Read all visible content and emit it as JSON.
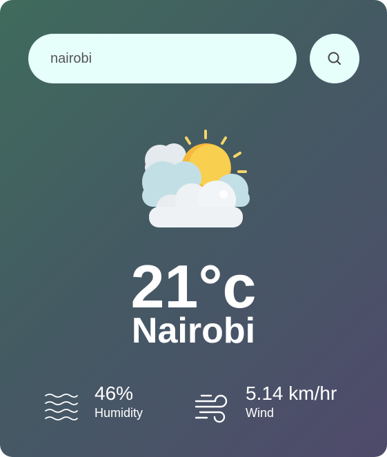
{
  "search": {
    "value": "nairobi",
    "placeholder": ""
  },
  "icons": {
    "search_button": "search-icon",
    "condition": "partly-cloudy-icon",
    "humidity": "water-waves-icon",
    "wind": "wind-icon"
  },
  "weather": {
    "temperature": "21°c",
    "city": "Nairobi"
  },
  "details": {
    "humidity": {
      "value": "46%",
      "label": "Humidity"
    },
    "wind": {
      "value": "5.14 km/hr",
      "label": "Wind"
    }
  },
  "colors": {
    "input_bg": "#e6fffb",
    "sun": "#f7c948",
    "cloud": "#eef2f5",
    "text": "#ffffff"
  }
}
